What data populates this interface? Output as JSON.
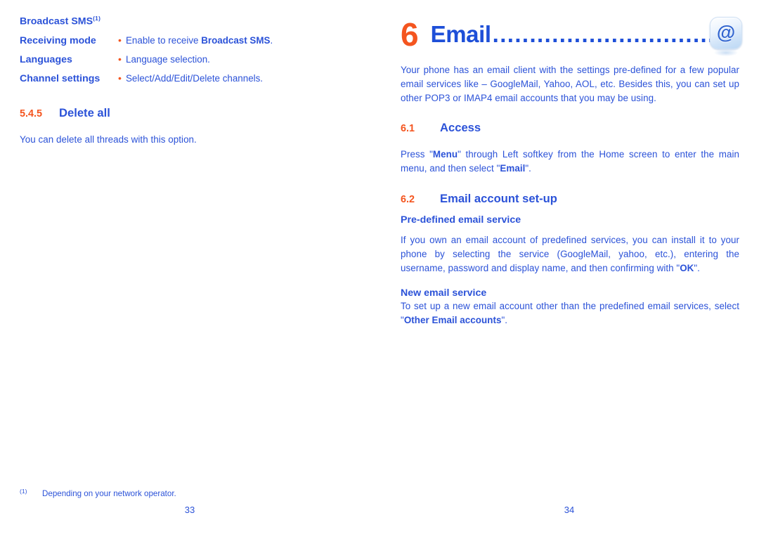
{
  "document": {
    "type": "user-manual-spread",
    "colors": {
      "body_blue": "#2b52d8",
      "heading_blue": "#1e4fd8",
      "accent_orange": "#f4551f",
      "background": "#ffffff"
    }
  },
  "left_page": {
    "folio": "33",
    "deflist": {
      "title": "Broadcast SMS",
      "title_footnote_marker": "(1)",
      "bullet_glyph": "•",
      "rows": [
        {
          "term": "Receiving mode",
          "desc_prefix": "Enable to receive ",
          "desc_bold": "Broadcast SMS",
          "desc_suffix": "."
        },
        {
          "term": "Languages",
          "desc_prefix": "Language selection.",
          "desc_bold": "",
          "desc_suffix": ""
        },
        {
          "term": "Channel settings",
          "desc_prefix": "Select/Add/Edit/Delete channels.",
          "desc_bold": "",
          "desc_suffix": ""
        }
      ]
    },
    "section": {
      "number": "5.4.5",
      "title": "Delete all",
      "body": "You can delete all threads with this option."
    },
    "footnote": {
      "marker": "(1)",
      "text": "Depending on your network operator."
    }
  },
  "right_page": {
    "folio": "34",
    "chapter": {
      "number": "6",
      "title": "Email",
      "leader": "..................................................",
      "icon_name": "at-sign-icon",
      "icon_glyph": "@"
    },
    "intro": "Your phone has an email client with the settings pre-defined for a few popular email services like – GoogleMail, Yahoo, AOL, etc. Besides this, you can set up other POP3 or IMAP4 email accounts that you may be using.",
    "sections": [
      {
        "number": "6.1",
        "title": "Access",
        "paragraph": {
          "part1": "Press \"",
          "bold1": "Menu",
          "part2": "\" through Left softkey from the Home screen to enter the main menu, and then select \"",
          "bold2": "Email",
          "part3": "\"."
        }
      },
      {
        "number": "6.2",
        "title": "Email account set-up",
        "subsections": [
          {
            "heading": "Pre-defined email service",
            "part1": "If you own an email account of predefined services, you can install it to your phone by selecting the service (GoogleMail, yahoo, etc.), entering the username, password and display name, and then confirming with \"",
            "bold1": "OK",
            "part2": "\"."
          },
          {
            "heading": "New email service",
            "part1": "To set up a new email account other than the predefined email services, select \"",
            "bold1": "Other Email accounts",
            "part2": "\"."
          }
        ]
      }
    ]
  }
}
